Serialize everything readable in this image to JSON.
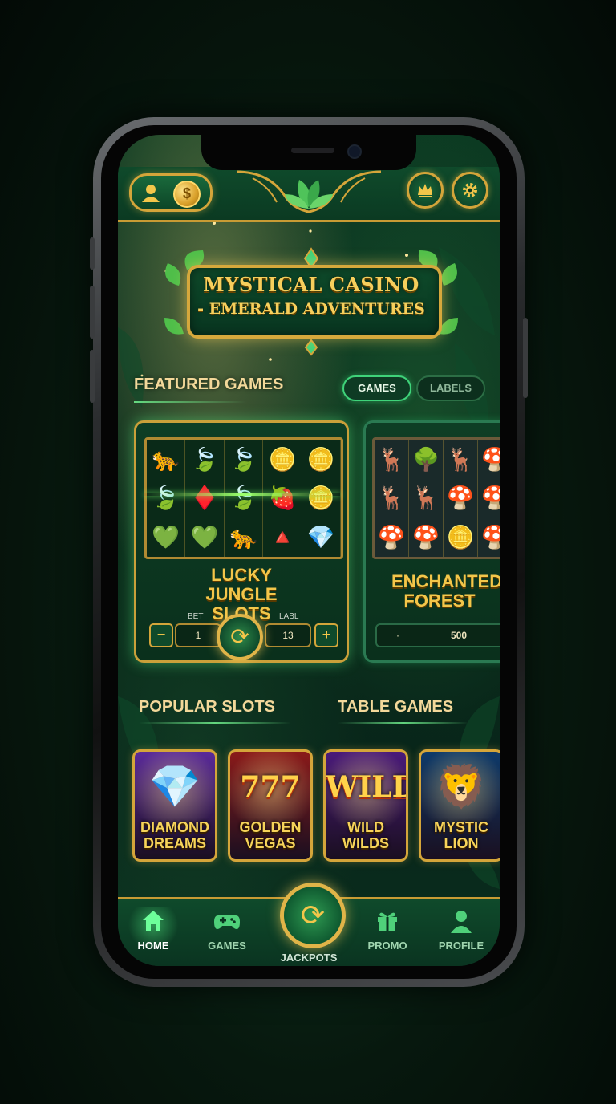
{
  "app": {
    "title_line1": "MYSTICAL CASINO",
    "title_line2": "- EMERALD ADVENTURES"
  },
  "topbar": {
    "coin_symbol": "$",
    "profile_icon": "user-icon",
    "crown_icon": "crown-icon",
    "settings_icon": "gear-icon"
  },
  "featured": {
    "title": "FEATURED GAMES",
    "tabs": [
      {
        "label": "GAMES",
        "active": true
      },
      {
        "label": "LABELS",
        "active": false
      }
    ],
    "cards": [
      {
        "name": "LUCKY JUNGLE SLOTS",
        "reels": [
          [
            "🐆",
            "🍃",
            "🍃",
            "🪙",
            "🪙"
          ],
          [
            "🍃",
            "♦️",
            "🍃",
            "🍓",
            "🪙"
          ],
          [
            "💚",
            "💚",
            "🐆",
            "🔺",
            "💎"
          ]
        ],
        "bet_label": "BET",
        "bet_value": "1",
        "lines_label": "LABL",
        "lines_value": "13",
        "minus": "−",
        "plus": "+"
      },
      {
        "name": "ENCHANTED FOREST",
        "reels": [
          [
            "🦌",
            "🌳",
            "🦌",
            "🍄"
          ],
          [
            "🦌",
            "🦌",
            "🍄",
            "🍄"
          ],
          [
            "🍄",
            "🍄",
            "🪙",
            "🍄"
          ]
        ],
        "value_dot": "·",
        "value": "500"
      }
    ]
  },
  "sections": {
    "popular": "POPULAR SLOTS",
    "table": "TABLE GAMES"
  },
  "tiles": [
    {
      "line1": "DIAMOND",
      "line2": "DREAMS",
      "art": "💎",
      "bg": "#5a2a9a"
    },
    {
      "line1": "GOLDEN",
      "line2": "VEGAS",
      "art": "777",
      "bg": "#8a1a1a"
    },
    {
      "line1": "WILD",
      "line2": "WILDS",
      "art": "WILD",
      "bg": "#4a1a7a"
    },
    {
      "line1": "MYSTIC",
      "line2": "LION",
      "art": "🦁",
      "bg": "#0e3a6a"
    }
  ],
  "nav": {
    "home": "HOME",
    "games": "GAMES",
    "jackpots": "JACKPOTS",
    "promo": "PROMO",
    "profile": "PROFILE"
  },
  "colors": {
    "accent_gold": "#f3c64a",
    "accent_green": "#3fd37a",
    "background": "#0a2b1a"
  }
}
